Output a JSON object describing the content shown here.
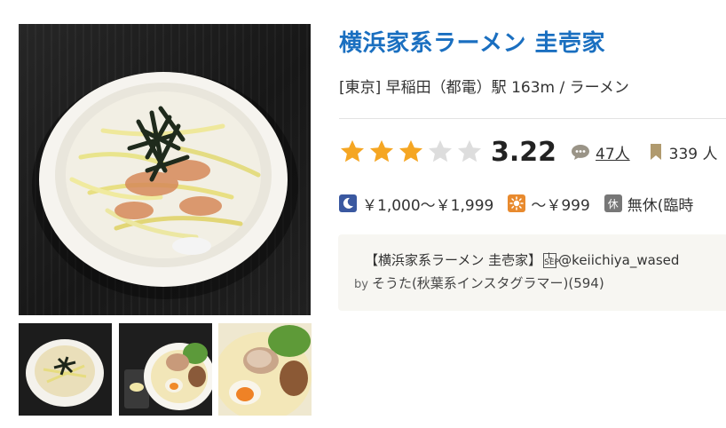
{
  "restaurant": {
    "name": "横浜家系ラーメン 圭壱家",
    "location": "[東京] 早稲田（都電）駅 163m / ラーメン"
  },
  "rating": {
    "score": "3.22",
    "stars_filled": 3,
    "stars_total": 5,
    "reviews": "47人",
    "bookmarks": "339 人"
  },
  "prices": {
    "dinner": "￥1,000～￥1,999",
    "lunch": "～￥999",
    "holiday_badge": "休",
    "holiday": "無休(臨時"
  },
  "review_snippet": {
    "title_prefix": "【横浜家系ラーメン 圭壱家】",
    "title_suffix": "@keiichiya_wased",
    "by_label": "by",
    "author": "そうた(秋葉系インスタグラマー)(594)"
  },
  "icons": {
    "dinner": "moon-icon",
    "lunch": "sun-icon",
    "reviews": "speech-bubble-icon",
    "bookmark": "bookmark-icon"
  },
  "colors": {
    "title": "#1a6fc0",
    "star_filled": "#f5a623",
    "star_empty": "#dddddd",
    "review_box_bg": "#f7f6f2"
  }
}
